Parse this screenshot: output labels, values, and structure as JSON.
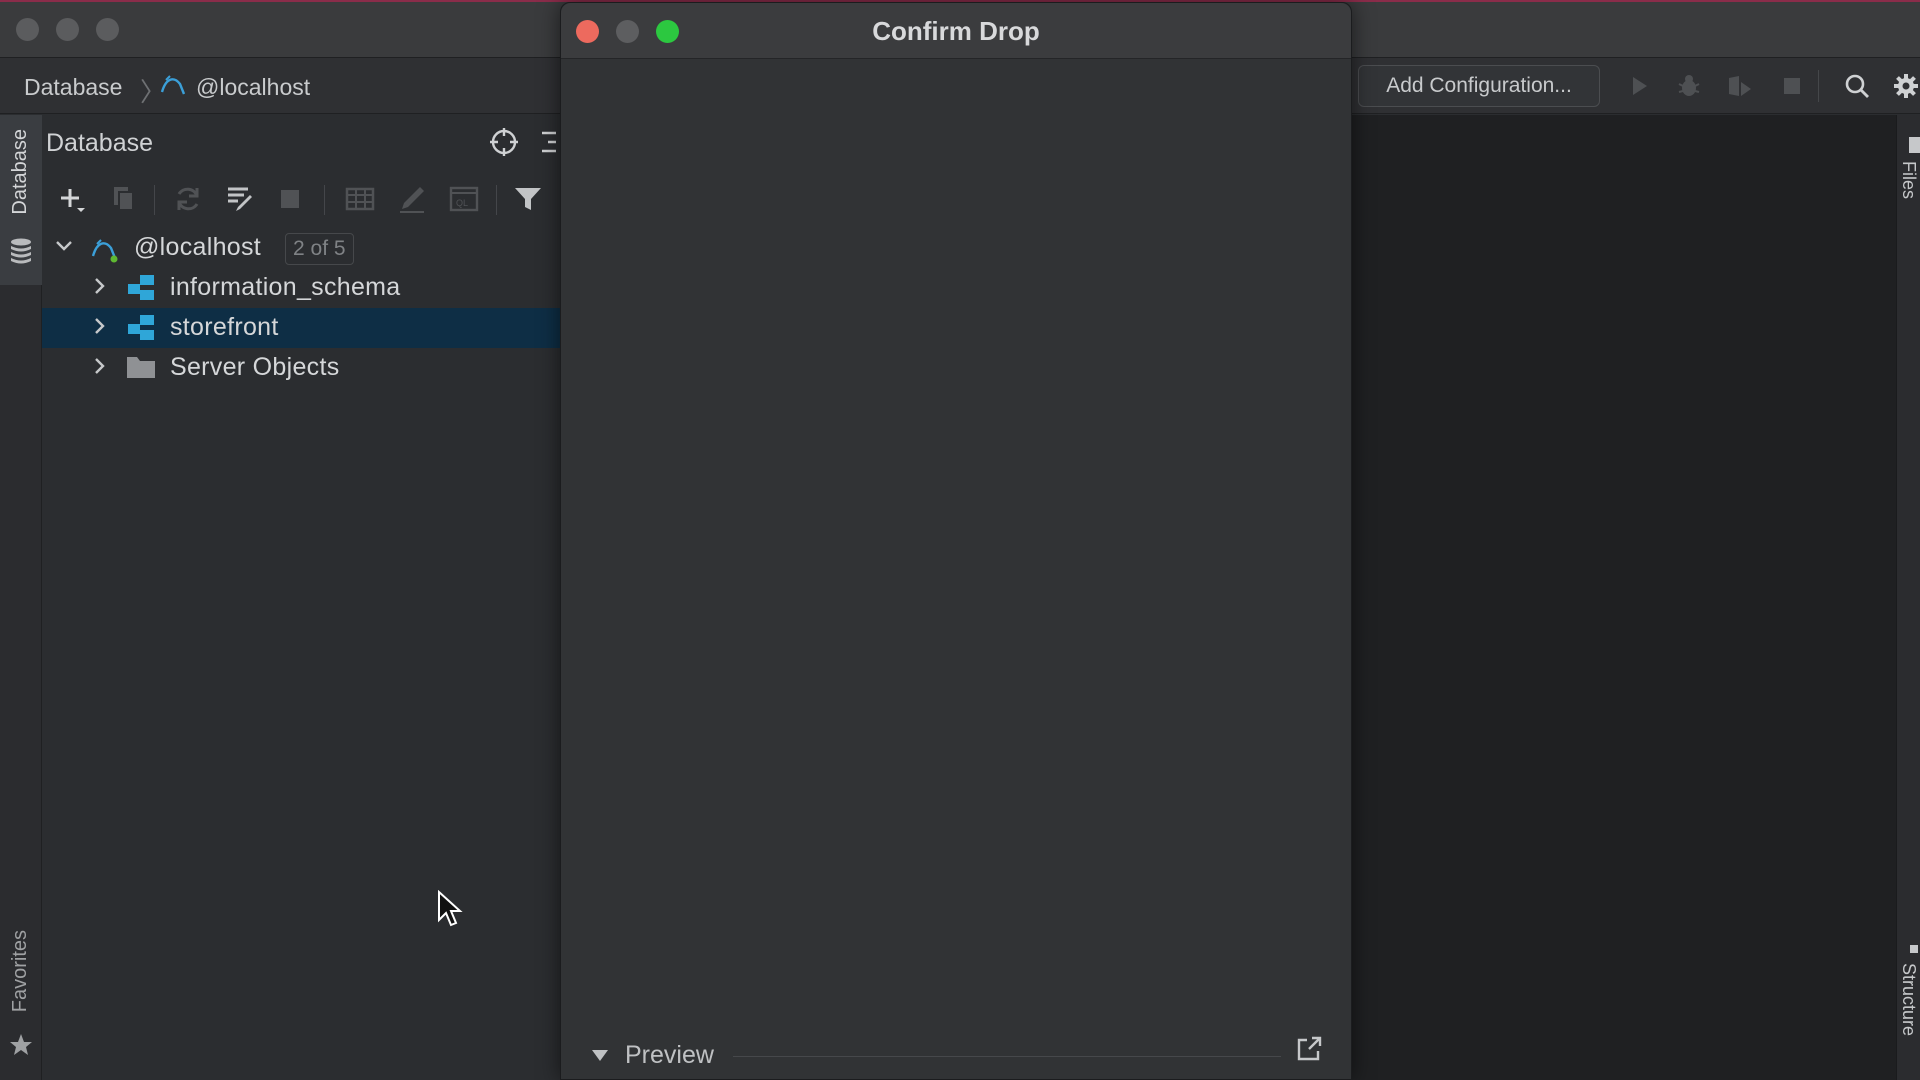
{
  "breadcrumb": {
    "root": "Database",
    "datasource": "@localhost"
  },
  "toolbar": {
    "run_config_label": "Add Configuration..."
  },
  "left_strip": {
    "database_tab": "Database",
    "favorites_tab": "Favorites"
  },
  "right_strip": {
    "files_tab": "Files",
    "structure_tab": "Structure"
  },
  "db_panel": {
    "title": "Database",
    "tree": {
      "datasource_label": "@localhost",
      "datasource_count": "2 of 5",
      "items": [
        {
          "label": "information_schema",
          "icon": "schema-icon",
          "selected": false
        },
        {
          "label": "storefront",
          "icon": "schema-icon",
          "selected": true
        },
        {
          "label": "Server Objects",
          "icon": "folder-icon",
          "selected": false
        }
      ]
    }
  },
  "dialog": {
    "title": "Confirm Drop",
    "preview_label": "Preview"
  },
  "colors": {
    "close": "#ed6a5e",
    "minimize": "#5d5e60",
    "zoom": "#2cc840",
    "selection": "#0e2e45",
    "schema_icon": "#2fa6d8"
  }
}
